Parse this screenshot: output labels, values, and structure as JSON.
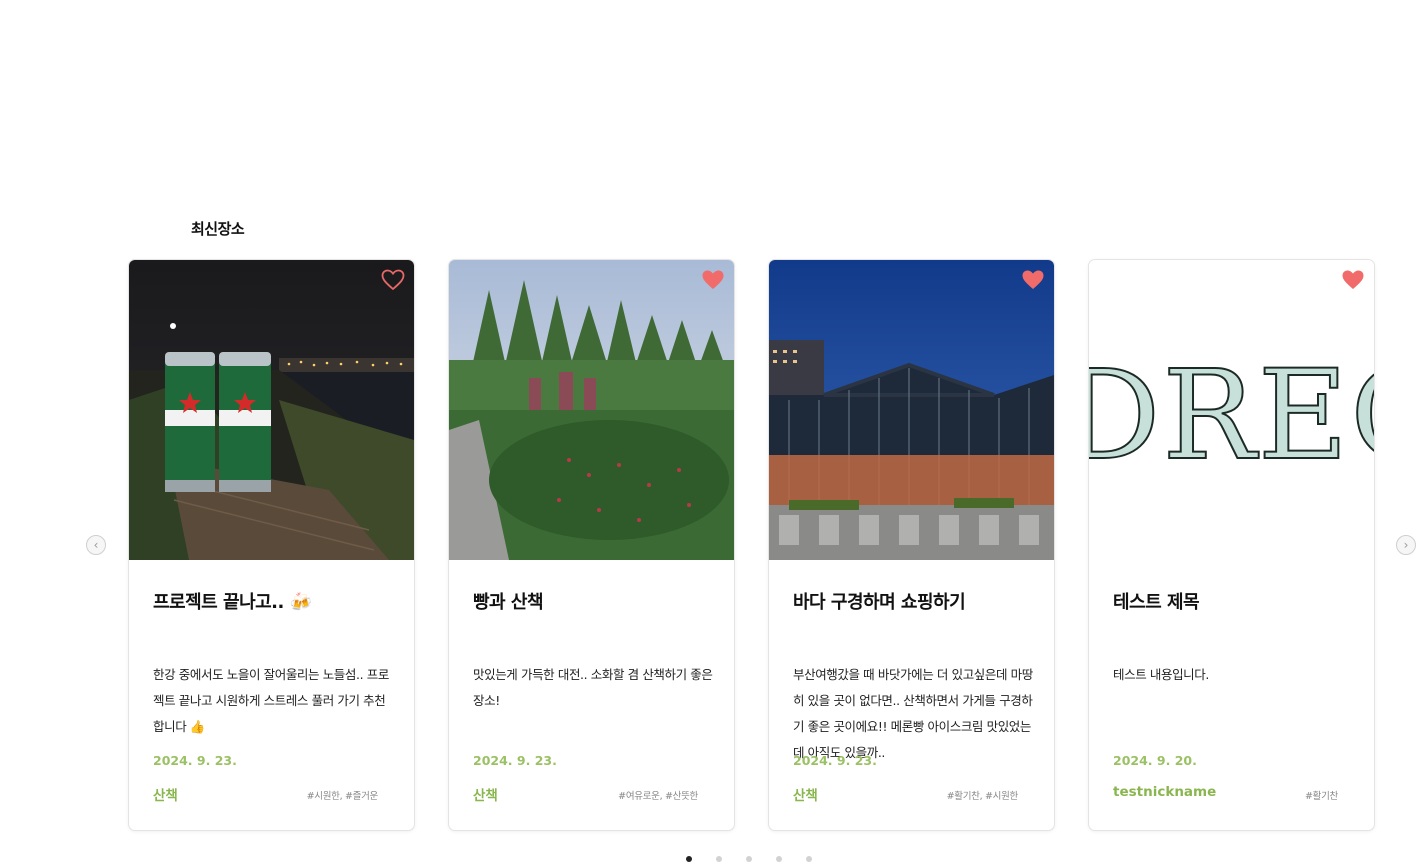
{
  "section": {
    "title": "최신장소"
  },
  "cards": [
    {
      "title": "프로젝트 끝나고.. 🍻",
      "description": "한강 중에서도 노을이 잘어울리는 노들섬.. 프로젝트 끝나고 시원하게 스트레스 풀러 가기 추천합니다 👍",
      "date": "2024. 9. 23.",
      "category": "산책",
      "tags": "#시원한, #즐거운",
      "liked": false
    },
    {
      "title": "빵과 산책",
      "description": "맛있는게 가득한 대전.. 소화할 겸 산책하기 좋은 장소!",
      "date": "2024. 9. 23.",
      "category": "산책",
      "tags": "#여유로운, #산뜻한",
      "liked": true
    },
    {
      "title": "바다 구경하며 쇼핑하기",
      "description": "부산여행갔을 때 바닷가에는 더 있고싶은데 마땅히 있을 곳이 없다면.. 산책하면서 가게들 구경하기 좋은 곳이에요!! 메론빵 아이스크림 맛있었는데 아직도 있을까..",
      "date": "2024. 9. 23.",
      "category": "산책",
      "tags": "#활기찬, #시원한",
      "liked": true
    },
    {
      "title": "테스트 제목",
      "description": "테스트 내용입니다.",
      "date": "2024. 9. 20.",
      "category": "testnickname",
      "tags": "#활기찬",
      "liked": true,
      "image_text": "DREC"
    }
  ],
  "icons": {
    "heart": "heart-icon",
    "prev": "chevron-left-icon",
    "next": "chevron-right-icon"
  },
  "colors": {
    "accent_green": "#8ab64f",
    "heart_red": "#f16b6b",
    "heart_outline": "#e86868"
  },
  "pagination": {
    "total": 5,
    "active": 0
  }
}
